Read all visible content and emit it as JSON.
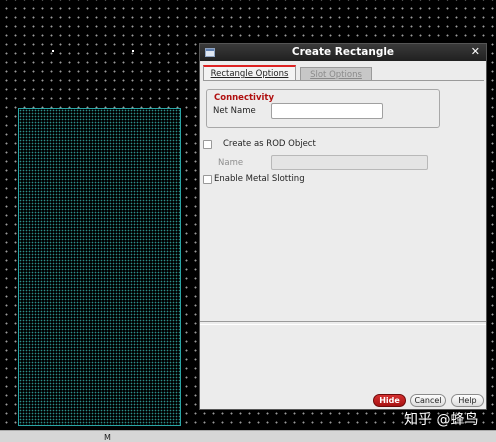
{
  "dialog": {
    "title": "Create Rectangle",
    "close_glyph": "✕",
    "tabs": [
      {
        "label": "Rectangle Options",
        "active": true
      },
      {
        "label": "Slot Options",
        "active": false
      }
    ],
    "connectivity": {
      "group_title": "Connectivity",
      "net_name_label": "Net Name",
      "net_name_value": ""
    },
    "rod": {
      "checkbox_label": "Create as ROD Object",
      "checked": false,
      "name_label": "Name",
      "name_value": ""
    },
    "metal_slotting": {
      "checkbox_label": "Enable Metal Slotting",
      "checked": false
    },
    "buttons": {
      "hide": "Hide",
      "cancel": "Cancel",
      "help": "Help"
    }
  },
  "statusbar": {
    "mouse_label": "M"
  },
  "watermark": {
    "text": "知乎 @蜂鸟"
  },
  "colors": {
    "canvas_background": "#000000",
    "grid_dot": "#9a9a9a",
    "layout_rect_border": "#2aa6a6",
    "group_title": "#b01010",
    "primary_button": "#c02020"
  }
}
